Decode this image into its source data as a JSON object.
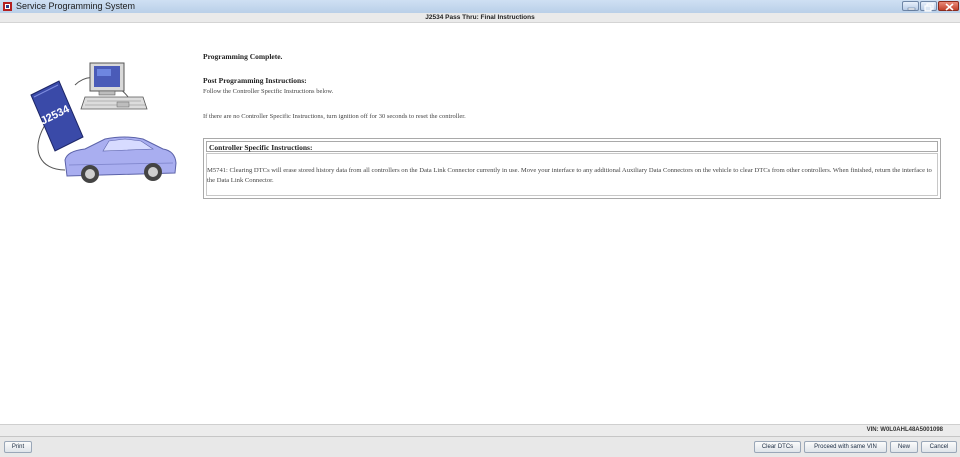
{
  "window": {
    "title": "Service Programming System",
    "icon": "sps-app-icon"
  },
  "page": {
    "header": "J2534 Pass Thru: Final Instructions"
  },
  "illustration": {
    "device_label": "J2534",
    "car_color": "#a9aef0"
  },
  "content": {
    "status": "Programming Complete.",
    "post_heading": "Post Programming Instructions:",
    "post_text": "Follow the Controller Specific Instructions below.",
    "no_instructions_note": "If there are no Controller Specific Instructions, turn ignition off for 30 seconds to reset the controller.",
    "controller_heading": "Controller Specific Instructions:",
    "controller_text": "M5741: Clearing DTCs will erase stored history data from all controllers on the Data Link Connector currently in use. Move your interface to any additional Auxiliary Data Connectors on the vehicle to clear DTCs from other controllers. When finished, return the interface to the Data Link Connector."
  },
  "status_bar": {
    "vin": "VIN: W0L0AHL48A5001098"
  },
  "toolbar": {
    "print": "Print",
    "clear_dtcs": "Clear DTCs",
    "proceed": "Proceed with same VIN",
    "new": "New",
    "cancel": "Cancel"
  },
  "colors": {
    "titlebar": "#b9cfe8",
    "close_button": "#c2412b",
    "device": "#3a4aa8"
  }
}
